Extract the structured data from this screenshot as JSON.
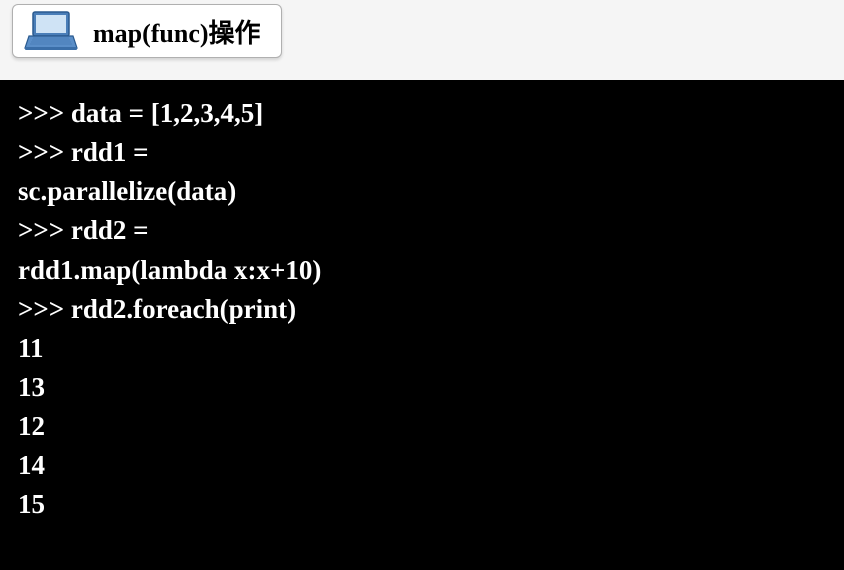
{
  "header": {
    "title": "map(func)操作"
  },
  "terminal": {
    "lines": [
      ">>> data = [1,2,3,4,5]",
      ">>> rdd1 =",
      "sc.parallelize(data)",
      ">>> rdd2 =",
      "rdd1.map(lambda x:x+10)",
      ">>> rdd2.foreach(print)",
      "11",
      "13",
      "12",
      "14",
      "15"
    ]
  }
}
